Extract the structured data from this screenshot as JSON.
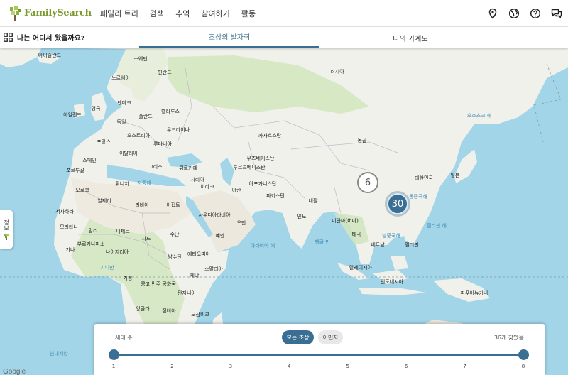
{
  "nav": {
    "logo_text": "FamilySearch",
    "items": [
      "패밀리 트리",
      "검색",
      "추억",
      "참여하기",
      "활동"
    ],
    "icons": [
      "location-pin-icon",
      "globe-icon",
      "help-icon",
      "chat-icon"
    ]
  },
  "subbar": {
    "title": "나는 어디서 왔을까요?",
    "tabs": [
      {
        "label": "조상의 발자취",
        "active": true
      },
      {
        "label": "나의 가계도",
        "active": false
      }
    ]
  },
  "map": {
    "countries": [
      "아이슬란드",
      "스웨덴",
      "핀란드",
      "노르웨이",
      "러시아",
      "덴마크",
      "영국",
      "아일랜드",
      "벨라루스",
      "폴란드",
      "독일",
      "우크라이나",
      "오스트리아",
      "프랑스",
      "루마니아",
      "이탈리아",
      "스페인",
      "포르투갈",
      "그리스",
      "튀르키예",
      "카자흐스탄",
      "몽골",
      "우즈베키스탄",
      "투르크메니스탄",
      "시리아",
      "이라크",
      "이란",
      "아프가니스탄",
      "파키스탄",
      "네팔",
      "모로코",
      "알제리",
      "리비아",
      "이집트",
      "튀니지",
      "사우디아라비아",
      "오만",
      "예멘",
      "인도",
      "미얀마(버마)",
      "태국",
      "베트남",
      "필리핀",
      "대한민국",
      "일본",
      "서사하라",
      "말리",
      "모리타니",
      "니제르",
      "차드",
      "수단",
      "부르키나파소",
      "나이지리아",
      "가나",
      "남수단",
      "에티오피아",
      "소말리아",
      "케냐",
      "가봉",
      "콩고 민주 공화국",
      "탄자니아",
      "앙골라",
      "잠비아",
      "모잠비크",
      "말레이시아",
      "인도네시아",
      "파푸아뉴기니"
    ],
    "seas": [
      "지중해",
      "동중국해",
      "남중국해",
      "필리핀 해",
      "오호츠크 해",
      "벵골 만",
      "아라비아 해",
      "기니만",
      "남대서양"
    ],
    "clusters": [
      {
        "count": "6"
      },
      {
        "count": "30"
      }
    ],
    "side_tab_label": "정보",
    "attribution": "Google"
  },
  "panel": {
    "generations_label": "세대 수",
    "filters": [
      {
        "label": "모든 조상",
        "active": true
      },
      {
        "label": "이민자",
        "active": false
      }
    ],
    "found_text": "36개 찾았음",
    "ticks": [
      "1",
      "2",
      "3",
      "4",
      "5",
      "6",
      "7",
      "8"
    ],
    "range": {
      "min": 1,
      "max": 8
    }
  },
  "colors": {
    "accent": "#3a6f93",
    "water": "#a3d5e9",
    "land": "#f1f1ec",
    "forest": "#c8e2b9",
    "desert": "#ece8dd"
  }
}
